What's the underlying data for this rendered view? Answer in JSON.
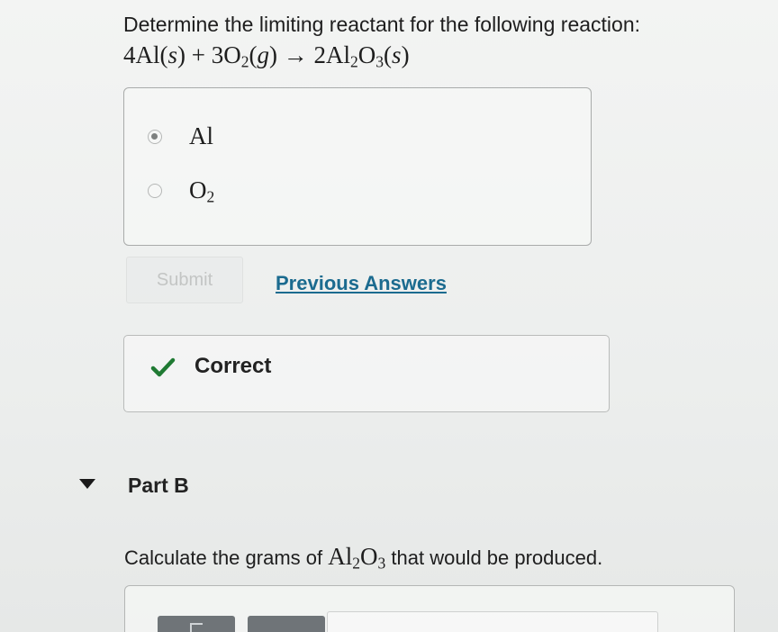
{
  "part_a": {
    "question": "Determine the limiting reactant for the following reaction:",
    "equation": {
      "reactant1_coef": "4",
      "reactant1": "Al",
      "reactant1_state": "s",
      "plus": "+",
      "reactant2_coef": "3",
      "reactant2": "O",
      "reactant2_sub": "2",
      "reactant2_state": "g",
      "arrow": "→",
      "product_coef": "2",
      "product_a": "Al",
      "product_a_sub": "2",
      "product_b": "O",
      "product_b_sub": "3",
      "product_state": "s"
    },
    "choices": [
      {
        "label": "Al",
        "sub": "",
        "selected": true
      },
      {
        "label": "O",
        "sub": "2",
        "selected": false
      }
    ],
    "submit_label": "Submit",
    "previous_answers_label": "Previous Answers",
    "feedback": {
      "icon": "checkmark-icon",
      "text": "Correct",
      "color": "#1f7a33"
    }
  },
  "part_b": {
    "title": "Part B",
    "question_before": "Calculate the grams of",
    "formula_a": "Al",
    "formula_a_sub": "2",
    "formula_b": "O",
    "formula_b_sub": "3",
    "question_after": "that would be produced."
  },
  "colors": {
    "link": "#1b6b8f",
    "check": "#1f7a33",
    "toolbar": "#6f7478"
  }
}
